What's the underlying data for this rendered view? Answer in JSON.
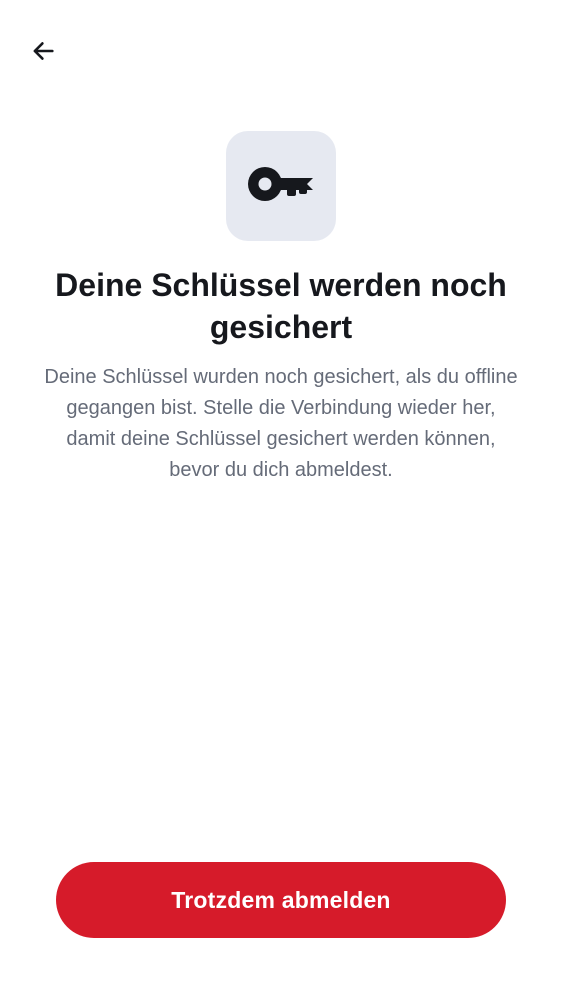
{
  "header": {
    "back_icon": "arrow-left-icon"
  },
  "hero": {
    "icon": "key-icon",
    "tile_color": "#e6e9f1"
  },
  "content": {
    "title": "Deine Schlüssel werden noch gesichert",
    "description": "Deine Schlüssel wurden noch gesichert, als du offline gegangen bist. Stelle die Verbindung wieder her, damit deine Schlüssel gesichert werden können, bevor du dich abmeldest."
  },
  "actions": {
    "logout_anyway_label": "Trotzdem abmelden",
    "accent_color": "#d61b2a"
  }
}
